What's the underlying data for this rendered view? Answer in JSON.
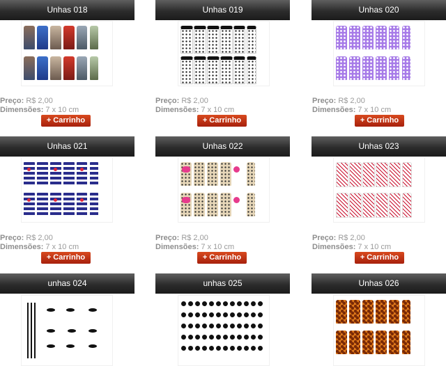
{
  "products": [
    {
      "name": "Unhas 018",
      "price_label": "Preço:",
      "price": "R$ 2,00",
      "dim_label": "Dimensões:",
      "dim": "7 x 10 cm",
      "cart": "+ Carrinho",
      "pattern": "city-photos"
    },
    {
      "name": "Unhas 019",
      "price_label": "Preço:",
      "price": "R$ 2,00",
      "dim_label": "Dimensões:",
      "dim": "7 x 10 cm",
      "cart": "+ Carrinho",
      "pattern": "white-black-dots"
    },
    {
      "name": "Unhas 020",
      "price_label": "Preço:",
      "price": "R$ 2,00",
      "dim_label": "Dimensões:",
      "dim": "7 x 10 cm",
      "cart": "+ Carrinho",
      "pattern": "purple-polka-dots"
    },
    {
      "name": "Unhas 021",
      "price_label": "Preço:",
      "price": "R$ 2,00",
      "dim_label": "Dimensões:",
      "dim": "7 x 10 cm",
      "cart": "+ Carrinho",
      "pattern": "navy-stripes-red-anchor"
    },
    {
      "name": "Unhas 022",
      "price_label": "Preço:",
      "price": "R$ 2,00",
      "dim_label": "Dimensões:",
      "dim": "7 x 10 cm",
      "cart": "+ Carrinho",
      "pattern": "beige-dots-pink-bows"
    },
    {
      "name": "Unhas 023",
      "price_label": "Preço:",
      "price": "R$ 2,00",
      "dim_label": "Dimensões:",
      "dim": "7 x 10 cm",
      "cart": "+ Carrinho",
      "pattern": "red-script-print"
    },
    {
      "name": "unhas 024",
      "cart": "+ Carrinho",
      "pattern": "black-stripes-bats"
    },
    {
      "name": "unhas 025",
      "cart": "+ Carrinho",
      "pattern": "black-white-floral"
    },
    {
      "name": "Unhas 026",
      "cart": "+ Carrinho",
      "pattern": "giraffe-print"
    }
  ],
  "colors": {
    "header_bg": "#2c2c2c",
    "cart_bg": "#c0300f",
    "info_text": "#9a9a9a"
  }
}
